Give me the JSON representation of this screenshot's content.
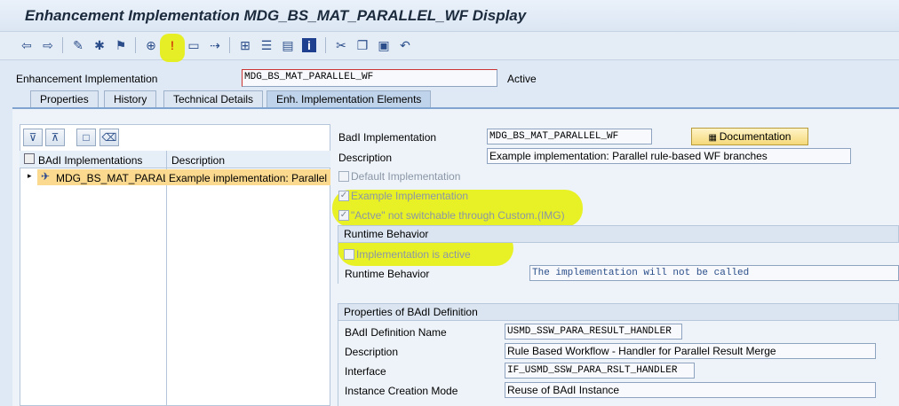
{
  "window": {
    "title": "Enhancement Implementation MDG_BS_MAT_PARALLEL_WF Display"
  },
  "header": {
    "impl_label": "Enhancement Implementation",
    "impl_value": "MDG_BS_MAT_PARALLEL_WF",
    "status": "Active"
  },
  "tabs": [
    {
      "label": "Properties"
    },
    {
      "label": "History"
    },
    {
      "label": "Technical Details"
    },
    {
      "label": "Enh. Implementation Elements"
    }
  ],
  "tree": {
    "col1": "BAdI Implementations",
    "col2": "Description",
    "row_name": "MDG_BS_MAT_PARALL",
    "row_desc": "Example implementation: Parallel"
  },
  "badi": {
    "impl_label": "BadI Implementation",
    "impl_value": "MDG_BS_MAT_PARALLEL_WF",
    "doc_button": "Documentation",
    "desc_label": "Description",
    "desc_value": "Example implementation: Parallel rule-based WF branches",
    "default_impl": "Default Implementation",
    "example_impl": "Example Implementation",
    "not_switchable": "\"Actve\" not switchable through Custom.(IMG)"
  },
  "runtime": {
    "header": "Runtime Behavior",
    "impl_active": "Implementation is active",
    "rb_label": "Runtime Behavior",
    "rb_value": "The implementation will not be called"
  },
  "definition": {
    "header": "Properties of BAdI Definition",
    "name_label": "BAdI Definition Name",
    "name_value": "USMD_SSW_PARA_RESULT_HANDLER",
    "desc_label": "Description",
    "desc_value": "Rule Based Workflow - Handler for Parallel Result Merge",
    "iface_label": "Interface",
    "iface_value": "IF_USMD_SSW_PARA_RSLT_HANDLER",
    "mode_label": "Instance Creation Mode",
    "mode_value": "Reuse of BAdI Instance"
  },
  "colors": {
    "highlight": "#e6f000",
    "active_tab": "#bfd3ea"
  }
}
